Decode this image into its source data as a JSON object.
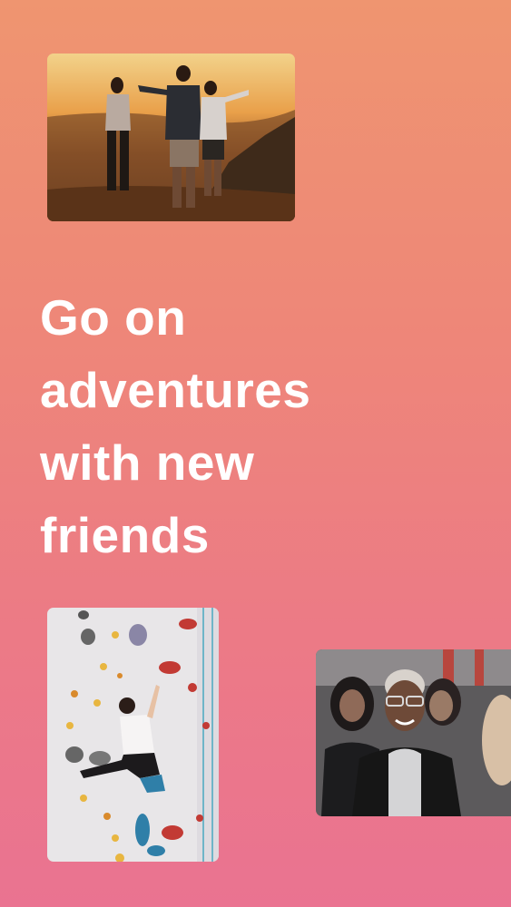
{
  "headline": {
    "line1": "Go on",
    "line2": "adventures",
    "line3": "with new",
    "line4": "friends"
  },
  "photos": [
    {
      "name": "sunset-friends-photo"
    },
    {
      "name": "rock-climbing-photo"
    },
    {
      "name": "laughing-friends-photo"
    }
  ],
  "colors": {
    "background_top": "#ef9570",
    "background_bottom": "#ea7391",
    "text": "#ffffff"
  }
}
